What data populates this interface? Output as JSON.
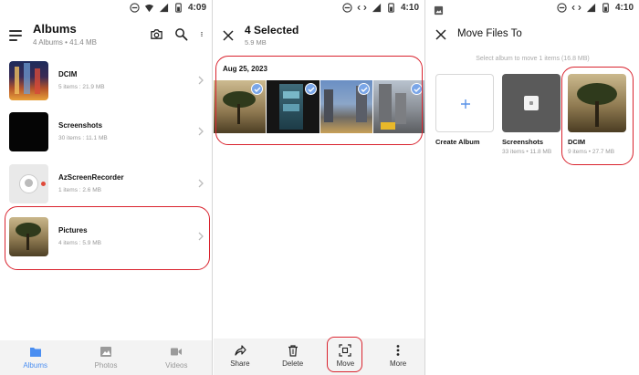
{
  "panel1": {
    "status": {
      "time": "4:09"
    },
    "header": {
      "title": "Albums",
      "subtitle": "4 Albums • 41.4 MB"
    },
    "albums": [
      {
        "name": "DCIM",
        "meta": "5 items : 21.9 MB"
      },
      {
        "name": "Screenshots",
        "meta": "30 items : 11.1 MB"
      },
      {
        "name": "AzScreenRecorder",
        "meta": "1 items : 2.6 MB"
      },
      {
        "name": "Pictures",
        "meta": "4 items : 5.9 MB"
      }
    ],
    "nav": [
      {
        "label": "Albums"
      },
      {
        "label": "Photos"
      },
      {
        "label": "Videos"
      }
    ]
  },
  "panel2": {
    "status": {
      "time": "4:10"
    },
    "header": {
      "title": "4 Selected",
      "subtitle": "5.9 MB"
    },
    "date": "Aug 25, 2023",
    "actions": [
      {
        "label": "Share"
      },
      {
        "label": "Delete"
      },
      {
        "label": "Move"
      },
      {
        "label": "More"
      }
    ]
  },
  "panel3": {
    "status": {
      "time": "4:10"
    },
    "header": {
      "title": "Move Files To"
    },
    "info": "Select album to move 1 items (16.8 MB)",
    "targets": [
      {
        "name": "Create Album",
        "meta": ""
      },
      {
        "name": "Screenshots",
        "meta": "33 items • 11.8 MB"
      },
      {
        "name": "DCIM",
        "meta": "9 items • 27.7 MB"
      }
    ]
  },
  "colors": {
    "accent": "#4a8ef1",
    "highlight": "#d9232e",
    "check": "#7aa6e8"
  }
}
